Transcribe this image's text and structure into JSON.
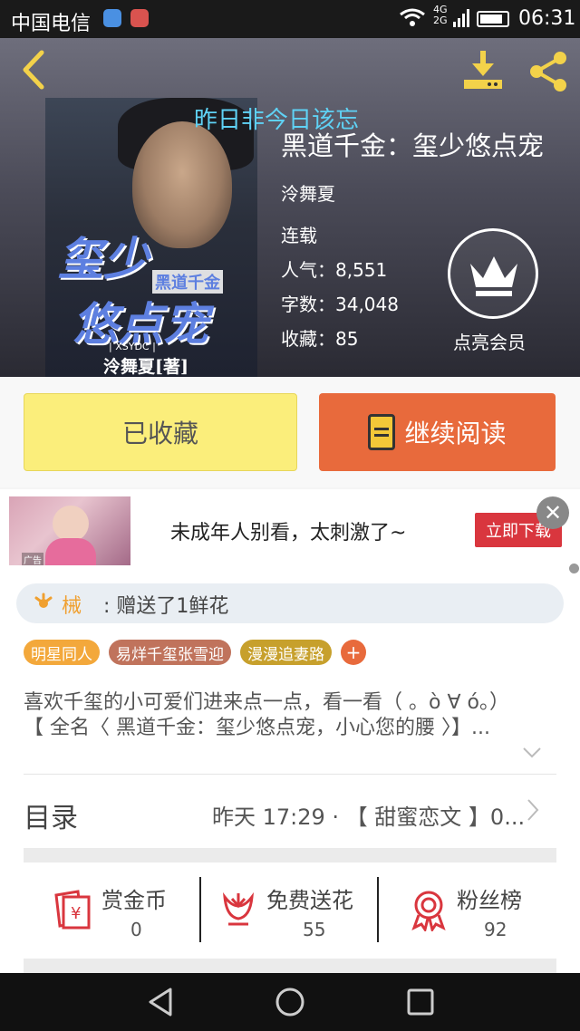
{
  "status_bar": {
    "carrier": "中国电信",
    "net_top": "4G",
    "net_bottom": "2G",
    "time": "06:31"
  },
  "header": {
    "overlay_caption": "昨日非今日该忘"
  },
  "cover": {
    "title_line1": "玺少",
    "title_small": "黑道千金",
    "title_line2": "悠点宠",
    "imprint": "| XSYDC |",
    "author_print": "泠舞夏[著]"
  },
  "book": {
    "title": "黑道千金：玺少悠点宠",
    "author": "泠舞夏",
    "status": "连载",
    "popularity": "人气：8,551",
    "word_count": "字数：34,048",
    "favorites": "收藏：85",
    "vip_label": "点亮会员"
  },
  "actions": {
    "favorited_label": "已收藏",
    "continue_label": "继续阅读"
  },
  "ad": {
    "thumb_tag": "广告",
    "text": "未成年人别看，太刺激了~",
    "button": "立即下载",
    "close": "✕"
  },
  "gift": {
    "user": "械",
    "text": ": 赠送了1鲜花"
  },
  "tags": [
    {
      "label": "明星同人",
      "color": "#f3a83b"
    },
    {
      "label": "易烊千玺张雪迎",
      "color": "#c0735c"
    },
    {
      "label": "漫漫追妻路",
      "color": "#c7a02c"
    }
  ],
  "tag_add": "+",
  "description": {
    "line1": "喜欢千玺的小可爱们进来点一点，看一看（ 。ò ∀ ó。）",
    "line2": "【 全名〈 黑道千金：玺少悠点宠，小心您的腰 〉】..."
  },
  "toc": {
    "title": "目录",
    "latest": "昨天 17:29 · 【 甜蜜恋文 】0..."
  },
  "stats": [
    {
      "label": "赏金币",
      "value": "0"
    },
    {
      "label": "免费送花",
      "value": "55"
    },
    {
      "label": "粉丝榜",
      "value": "92"
    }
  ],
  "colors": {
    "accent_orange": "#e86a3c",
    "favorite_yellow": "#fbee7b",
    "icon_red": "#d9363e"
  }
}
